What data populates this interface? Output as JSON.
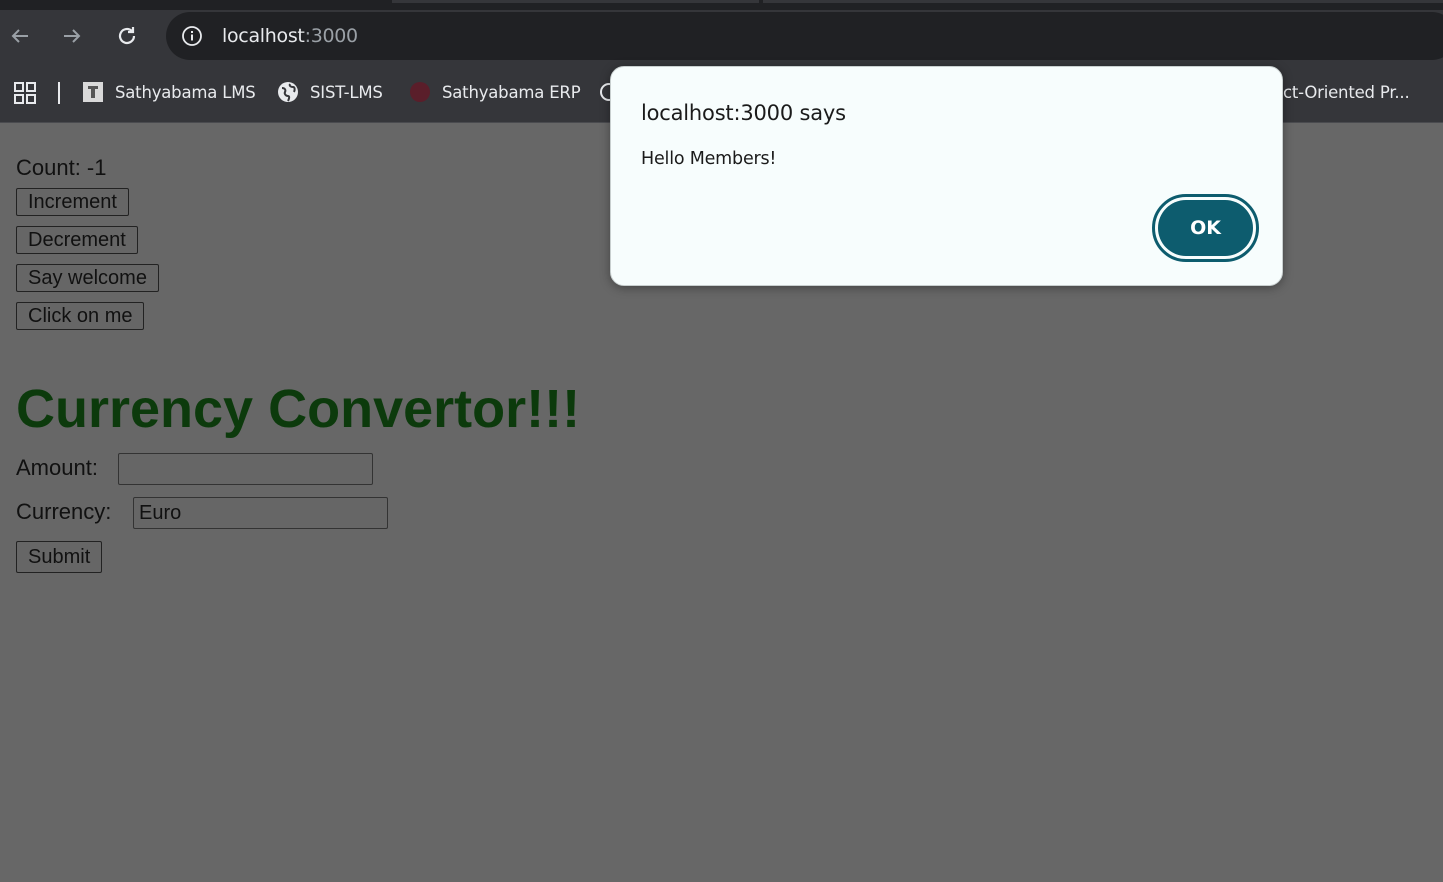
{
  "browser": {
    "url_host": "localhost",
    "url_port": ":3000",
    "bookmarks": [
      {
        "label": "Sathyabama LMS",
        "icon": "lms-favicon"
      },
      {
        "label": "SIST-LMS",
        "icon": "globe-icon"
      },
      {
        "label": "Sathyabama ERP",
        "icon": "erp-favicon"
      },
      {
        "label": "ct-Oriented Pr...",
        "icon": "none"
      }
    ]
  },
  "page": {
    "count_text": "Count: -1",
    "buttons": {
      "increment": "Increment",
      "decrement": "Decrement",
      "say_welcome": "Say welcome",
      "click_on_me": "Click on me"
    },
    "heading": "Currency Convertor!!!",
    "form": {
      "amount_label": "Amount:",
      "amount_value": "",
      "currency_label": "Currency:",
      "currency_value": "Euro",
      "submit_label": "Submit"
    }
  },
  "dialog": {
    "title": "localhost:3000 says",
    "message": "Hello Members!",
    "ok_label": "OK"
  },
  "colors": {
    "heading": "#0c3a0c",
    "ok_button": "#0d5c6e",
    "overlay": "#676767"
  }
}
